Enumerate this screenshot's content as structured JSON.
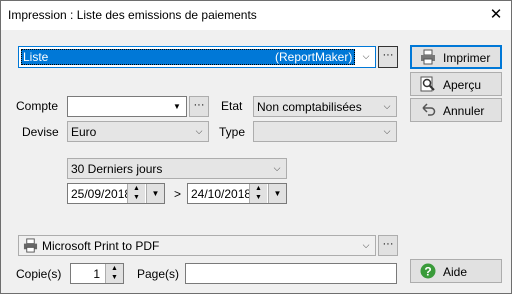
{
  "window": {
    "title": "Impression : Liste des emissions de paiements",
    "close_glyph": "✕"
  },
  "report": {
    "selected": "Liste",
    "maker": "(ReportMaker)"
  },
  "buttons": {
    "print": "Imprimer",
    "preview": "Aperçu",
    "cancel": "Annuler",
    "help": "Aide",
    "ellipsis": "···"
  },
  "fields": {
    "compte": {
      "label": "Compte",
      "value": ""
    },
    "etat": {
      "label": "Etat",
      "value": "Non comptabilisées"
    },
    "devise": {
      "label": "Devise",
      "value": "Euro"
    },
    "type": {
      "label": "Type",
      "value": ""
    }
  },
  "period": {
    "value": "30 Derniers jours",
    "start": "25/09/2018",
    "end": "24/10/2018",
    "separator": ">"
  },
  "printer": {
    "value": "Microsoft Print to PDF"
  },
  "copies": {
    "label": "Copie(s)",
    "value": "1"
  },
  "pages": {
    "label": "Page(s)",
    "value": ""
  }
}
